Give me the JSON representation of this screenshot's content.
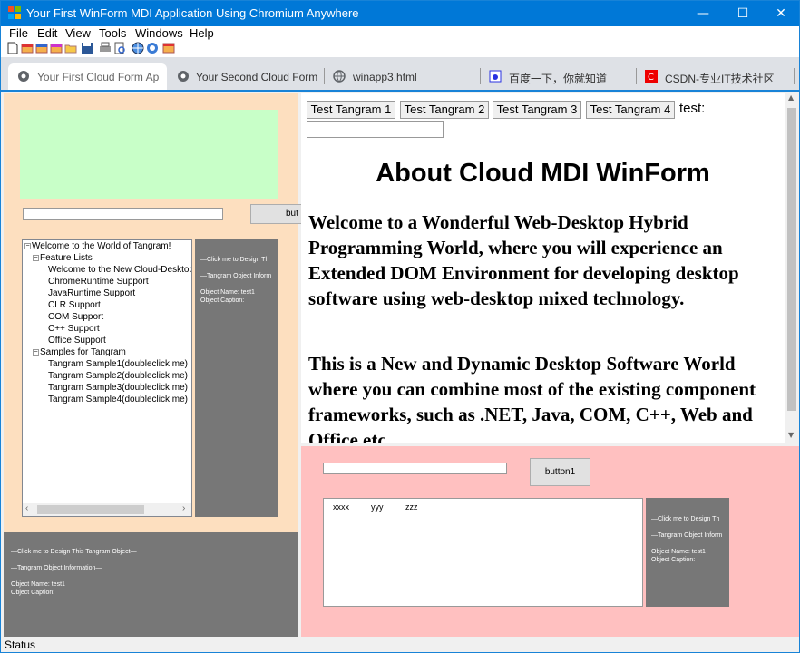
{
  "window": {
    "title": "Your First WinForm MDI Application Using Chromium Anywhere"
  },
  "menu": [
    "File",
    "Edit",
    "View",
    "Tools",
    "Windows",
    "Help"
  ],
  "tabs": [
    {
      "label": "Your First Cloud Form Ap",
      "active": true
    },
    {
      "label": "Your Second Cloud Form",
      "active": false
    },
    {
      "label": "winapp3.html",
      "active": false
    },
    {
      "label": "百度一下，你就知道",
      "active": false
    },
    {
      "label": "CSDN-专业IT技术社区",
      "active": false
    }
  ],
  "left_panel": {
    "button_label": "but",
    "tree": {
      "root": "Welcome to the World of Tangram!",
      "feature_lists": "Feature Lists",
      "features": [
        "Welcome to the New Cloud-Desktop",
        "ChromeRuntime Support",
        "JavaRuntime Support",
        "CLR Support",
        "COM Support",
        "C++ Support",
        "Office Support"
      ],
      "samples": "Samples for Tangram",
      "sample_items": [
        "Tangram Sample1(doubleclick me)",
        "Tangram Sample2(doubleclick me)",
        "Tangram Sample3(doubleclick me)",
        "Tangram Sample4(doubleclick me)"
      ]
    },
    "side_info": {
      "design_line": "—Click me to Design Th",
      "info_line": "—Tangram Object Inform",
      "object_name": "Object Name:  test1",
      "object_caption": "Object Caption:"
    },
    "bottom_info": {
      "design_line": "—Click me to Design This Tangram Object—",
      "info_line": "—Tangram Object Information—",
      "object_name": "Object Name:  test1",
      "object_caption": "Object Caption:"
    }
  },
  "web": {
    "buttons": [
      "Test Tangram 1",
      "Test Tangram 2",
      "Test Tangram 3",
      "Test Tangram 4"
    ],
    "test_label": "test:",
    "heading": "About Cloud MDI WinForm",
    "para1": "Welcome to a Wonderful Web-Desktop Hybrid Programming World, where you will experience an Extended DOM Environment for developing desktop software using web-desktop mixed technology.",
    "para2": "This is a New and Dynamic Desktop Software World where you can combine most of the existing component frameworks, such as .NET, Java, COM, C++, Web and Office etc."
  },
  "pink_panel": {
    "button_label": "button1",
    "list_items": [
      "xxxx",
      "yyy",
      "zzz"
    ],
    "info": {
      "design_line": "—Click me to Design Th",
      "info_line": "—Tangram Object Inform",
      "object_name": "Object Name:  test1",
      "object_caption": "Object Caption:"
    }
  },
  "status": "Status",
  "colors": {
    "titlebar": "#0078d7",
    "left_bg": "#fddfbf",
    "green": "#c8ffc8",
    "pink": "#ffc0c0",
    "grey_panel": "#777777"
  }
}
